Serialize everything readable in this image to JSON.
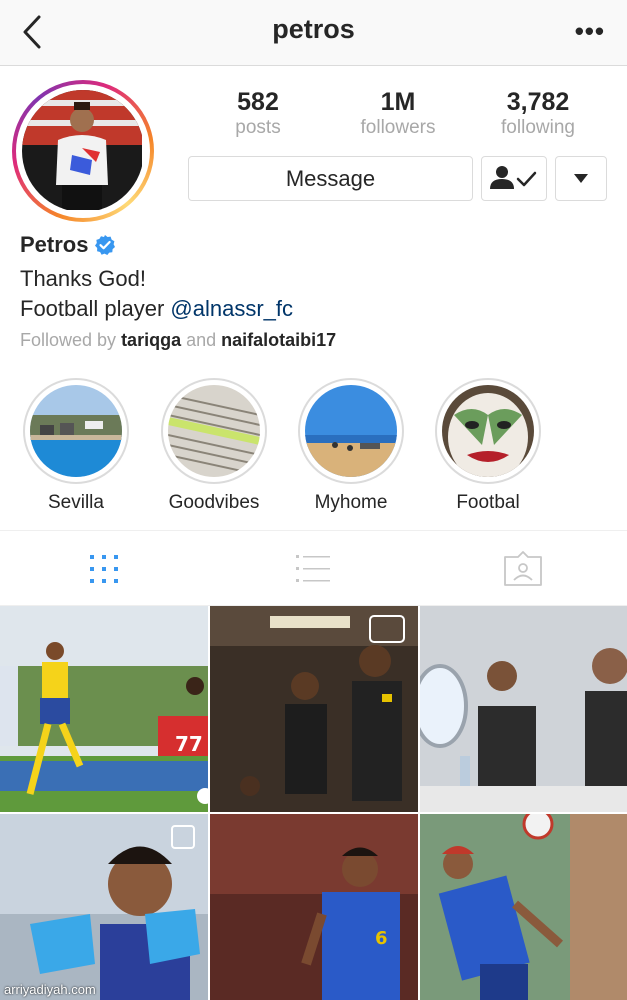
{
  "header": {
    "username": "petros",
    "more_label": "•••"
  },
  "stats": [
    {
      "value": "582",
      "label": "posts"
    },
    {
      "value": "1M",
      "label": "followers"
    },
    {
      "value": "3,782",
      "label": "following"
    }
  ],
  "actions": {
    "message_label": "Message"
  },
  "profile": {
    "name": "Petros",
    "bio_line1": "Thanks God!",
    "bio_line2_prefix": "Football player ",
    "bio_mention": "@alnassr_fc",
    "followed_prefix": "Followed by ",
    "followed_user1": "tariqga",
    "followed_and": " and ",
    "followed_user2": "naifalotaibi17"
  },
  "highlights": [
    {
      "label": "Sevilla"
    },
    {
      "label": "Goodvibes"
    },
    {
      "label": "Myhome"
    },
    {
      "label": "Footbal"
    }
  ],
  "watermark": "arriyadiyah.com",
  "colors": {
    "accent": "#3897f0",
    "mention": "#003569",
    "muted": "#a8a8a8",
    "border": "#dbdbdb"
  }
}
